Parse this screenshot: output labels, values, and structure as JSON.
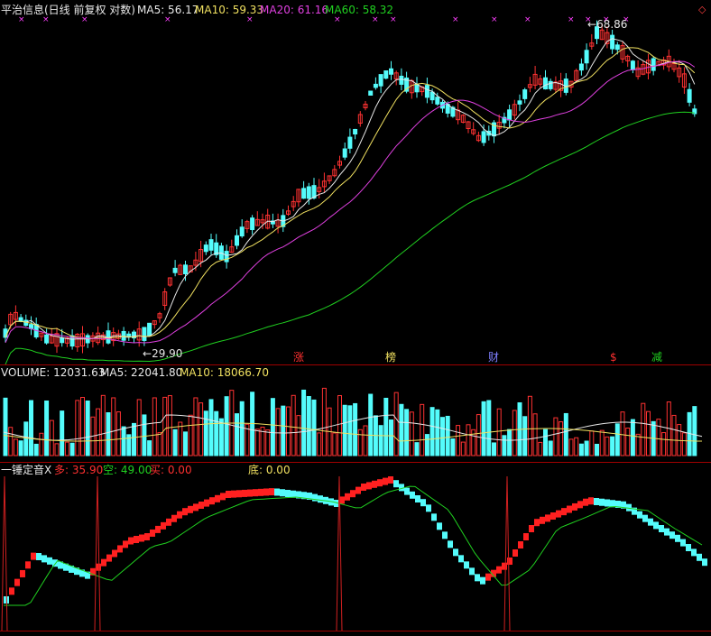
{
  "colors": {
    "up": "#ff3232",
    "down": "#54fcfc",
    "ma5": "#e8e8e8",
    "ma10": "#f0e060",
    "ma20": "#e040e0",
    "ma60": "#20d020",
    "divider": "#a00000",
    "marker": "#ff40ff"
  },
  "price_panel": {
    "stock_name": "平治信息",
    "mode_label": "(日线 前复权 对数)",
    "ma5_label": "MA5: 56.17",
    "ma10_label": "MA10: 59.33",
    "ma20_label": "MA20: 61.16",
    "ma60_label": "MA60: 58.32",
    "high_label": "68.86",
    "low_label": "29.90",
    "tags": [
      "涨",
      "榜",
      "财",
      "$",
      "减"
    ]
  },
  "volume_panel": {
    "volume_label": "VOLUME: 12031.63",
    "ma5_label": "MA5: 22041.80",
    "ma10_label": "MA10: 18066.70"
  },
  "indicator_panel": {
    "name_label": "一锤定音X",
    "duo_label": "多: 35.90",
    "kong_label": "空: 49.00",
    "mai_label": "买: 0.00",
    "di_label": "底: 0.00"
  },
  "chart_data": [
    {
      "type": "candlestick",
      "title": "平治信息(日线 前复权 对数)",
      "ylim": [
        29.9,
        68.86
      ],
      "scale": "log",
      "grid": false,
      "annotations": [
        {
          "text": "68.86",
          "kind": "high"
        },
        {
          "text": "29.90",
          "kind": "low"
        }
      ],
      "series": [
        {
          "name": "MA5",
          "last": 56.17
        },
        {
          "name": "MA10",
          "last": 59.33
        },
        {
          "name": "MA20",
          "last": 61.16
        },
        {
          "name": "MA60",
          "last": 58.32
        }
      ]
    },
    {
      "type": "bar",
      "title": "VOLUME",
      "series": [
        {
          "name": "VOLUME",
          "last": 12031.63
        },
        {
          "name": "MA5",
          "last": 22041.8
        },
        {
          "name": "MA10",
          "last": 18066.7
        }
      ]
    },
    {
      "type": "line",
      "title": "一锤定音X",
      "series": [
        {
          "name": "多",
          "last": 35.9
        },
        {
          "name": "空",
          "last": 49.0
        },
        {
          "name": "买",
          "last": 0.0
        },
        {
          "name": "底",
          "last": 0.0
        }
      ]
    }
  ]
}
